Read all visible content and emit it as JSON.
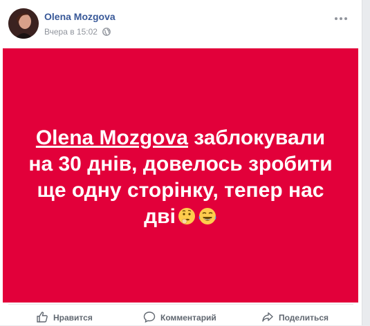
{
  "post": {
    "author_name": "Olena Mozgova",
    "timestamp": "Вчера в 15:02",
    "privacy_icon": "globe-icon",
    "avatar_icon": "profile-photo",
    "more_icon": "ellipsis-icon"
  },
  "banner": {
    "background_color": "#e2003a",
    "mention": "Olena Mozgova",
    "line1_rest": " заблокували",
    "line2": "на 30 днів, довелось зробити",
    "line3": "ще одну сторінку, тепер нас",
    "line4": "дві",
    "emoji1": "thinking-face-icon",
    "emoji2": "tears-of-joy-icon"
  },
  "actions": {
    "like_label": "Нравится",
    "comment_label": "Комментарий",
    "share_label": "Поделиться"
  }
}
